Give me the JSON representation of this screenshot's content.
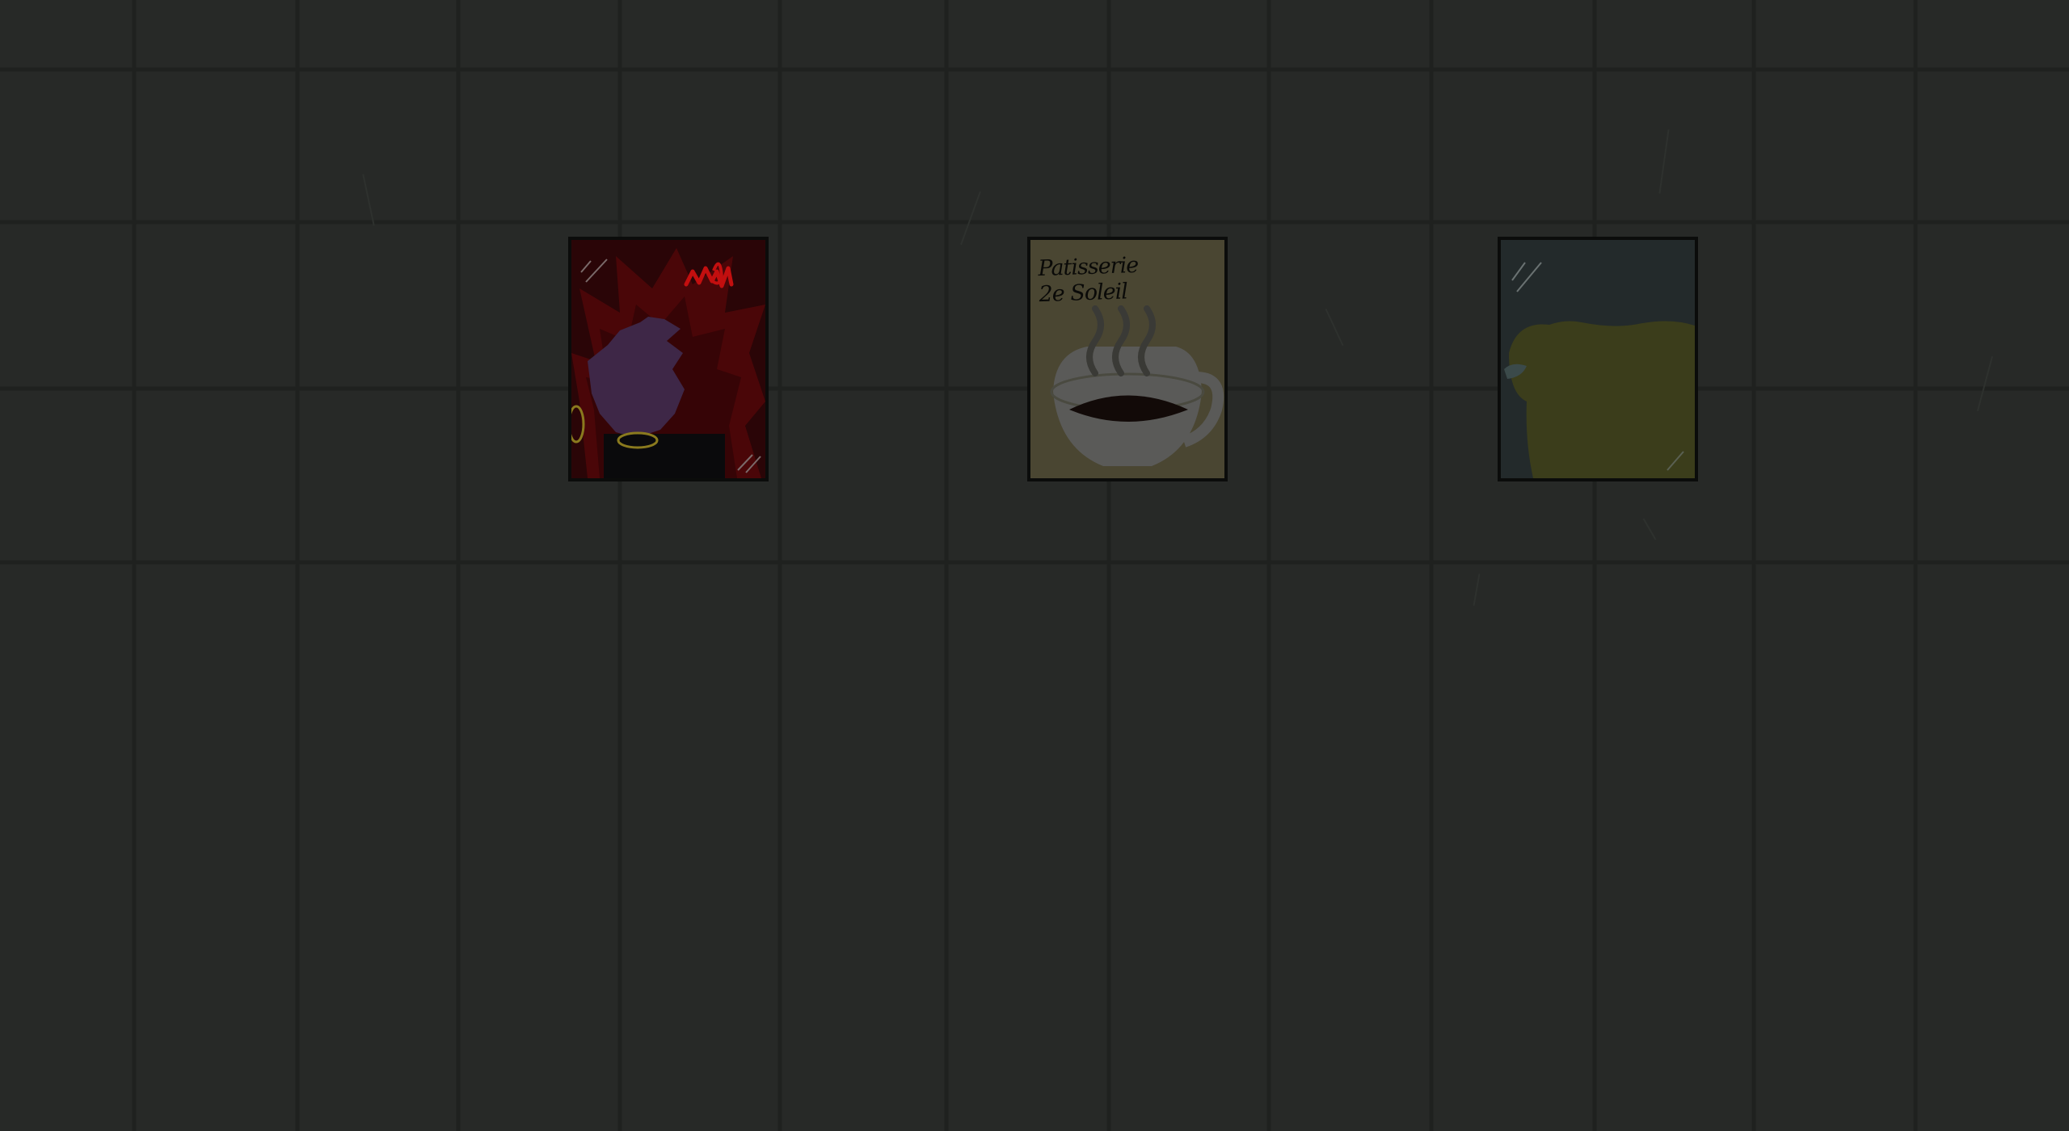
{
  "scene": {
    "background_color": "#272927",
    "grid_line_color": "#1f211f"
  },
  "posters": [
    {
      "name": "poster-left",
      "palette": {
        "bg": "#2a0507",
        "hair": "#4a0608",
        "face": "#3e2747",
        "accent": "#c20f0f",
        "gold": "#8a7a1e"
      },
      "icon": "character-portrait"
    },
    {
      "name": "poster-center",
      "lines": [
        "Patisserie",
        "2e Soleil"
      ],
      "palette": {
        "bg": "#4a4632",
        "cup": "#5a5a58",
        "coffee": "#120a08",
        "steam": "#3a3a36"
      },
      "icon": "coffee-cup-icon"
    },
    {
      "name": "poster-right",
      "palette": {
        "bg": "#232a2b",
        "blob": "#3b3d1b",
        "spot": "#3b4a4a"
      },
      "icon": "yellow-blob-icon"
    }
  ]
}
